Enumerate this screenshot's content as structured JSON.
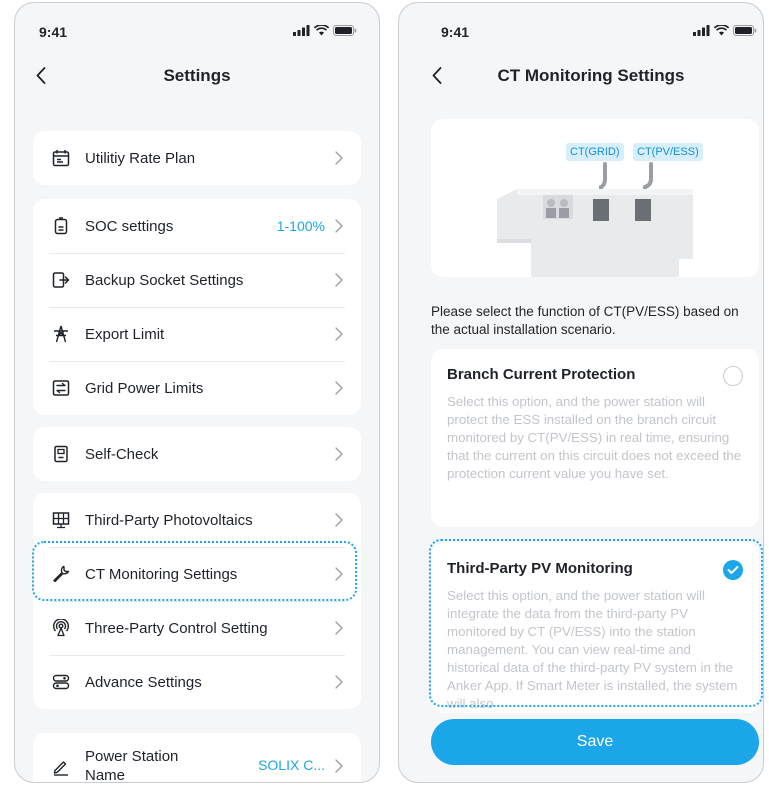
{
  "status": {
    "time": "9:41"
  },
  "left": {
    "title": "Settings",
    "card1": [
      {
        "label": "Utilitiy Rate Plan",
        "icon": "calendar-icon"
      }
    ],
    "card2": [
      {
        "label": "SOC settings",
        "value": "1-100%",
        "icon": "battery-icon"
      },
      {
        "label": "Backup Socket Settings",
        "icon": "socket-icon"
      },
      {
        "label": "Export Limit",
        "icon": "transmission-tower-icon"
      },
      {
        "label": "Grid Power Limits",
        "icon": "grid-power-icon"
      }
    ],
    "card3": [
      {
        "label": "Self-Check",
        "icon": "device-check-icon"
      }
    ],
    "card4": [
      {
        "label": "Third-Party Photovoltaics",
        "icon": "solar-panel-icon"
      },
      {
        "label": "CT Monitoring Settings",
        "icon": "wrench-icon"
      },
      {
        "label": "Three-Party Control Setting",
        "icon": "antenna-icon"
      },
      {
        "label": "Advance Settings",
        "icon": "toggles-icon"
      }
    ],
    "card5": [
      {
        "label_line1": "Power Station",
        "label_line2": "Name",
        "value": "SOLIX C...",
        "icon": "pencil-icon"
      }
    ]
  },
  "right": {
    "title": "CT Monitoring Settings",
    "diagram": {
      "tag_grid": "CT(GRID)",
      "tag_pv": "CT(PV/ESS)"
    },
    "instruction": "Please select the function of CT(PV/ESS) based on the actual installation scenario.",
    "option1": {
      "title": "Branch Current Protection",
      "desc": "Select this option, and the power station will protect the ESS installed on the branch circuit monitored by CT(PV/ESS) in real time, ensuring that the current on this circuit does not exceed the protection current value you have set.",
      "selected": false
    },
    "option2": {
      "title": "Third-Party PV Monitoring",
      "desc": "Select this option, and the power station will integrate the data from the third-party PV monitored by CT (PV/ESS) into the station management. You can view real-time and historical data of the third-party PV system in the Anker App. If Smart Meter is installed, the system will also",
      "selected": true
    },
    "save_label": "Save"
  },
  "colors": {
    "accent": "#1aa6e8",
    "background": "#f5f6f8",
    "card": "#ffffff",
    "muted_text": "#c2c5ca"
  }
}
